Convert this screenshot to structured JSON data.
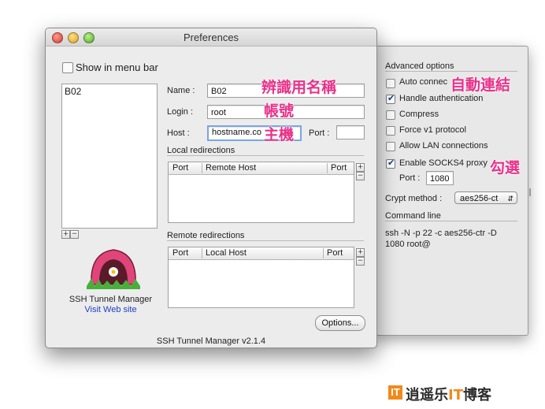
{
  "window": {
    "title": "Preferences",
    "show_in_menu_bar": "Show in menu bar",
    "footer_version": "SSH Tunnel Manager v2.1.4"
  },
  "tunnel_list": {
    "items": [
      "B02"
    ]
  },
  "form": {
    "name_label": "Name :",
    "name_value": "B02",
    "login_label": "Login :",
    "login_value": "root",
    "host_label": "Host :",
    "host_value": "hostname.co",
    "port_label": "Port :",
    "port_value": ""
  },
  "local_redirections": {
    "title": "Local redirections",
    "columns": [
      "Port",
      "Remote Host",
      "Port"
    ]
  },
  "remote_redirections": {
    "title": "Remote redirections",
    "columns": [
      "Port",
      "Local Host",
      "Port"
    ]
  },
  "branding": {
    "app_name": "SSH Tunnel Manager",
    "visit_link": "Visit Web site"
  },
  "options_button": "Options...",
  "advanced": {
    "title": "Advanced options",
    "auto_connect": "Auto connec",
    "handle_auth": "Handle authentication",
    "compress": "Compress",
    "force_v1": "Force v1 protocol",
    "allow_lan": "Allow LAN connections",
    "socks4": "Enable SOCKS4 proxy",
    "socks_port_label": "Port :",
    "socks_port_value": "1080",
    "crypt_label": "Crypt method :",
    "crypt_value": "aes256-ct",
    "command_line_title": "Command line",
    "command_line_1": "ssh -N -p 22 -c aes256-ctr -D",
    "command_line_2": "1080 root@"
  },
  "annotations": {
    "name": "辨識用名稱",
    "login": "帳號",
    "host": "主機",
    "auto": "自動連結",
    "check": "勾選"
  },
  "logo": {
    "mark": "IT",
    "text_a": "逍遥乐",
    "text_b": "IT",
    "text_c": "博客"
  },
  "colors": {
    "annotation": "#e8318a",
    "logo_accent": "#f08a1c",
    "link": "#1a3fc4"
  }
}
